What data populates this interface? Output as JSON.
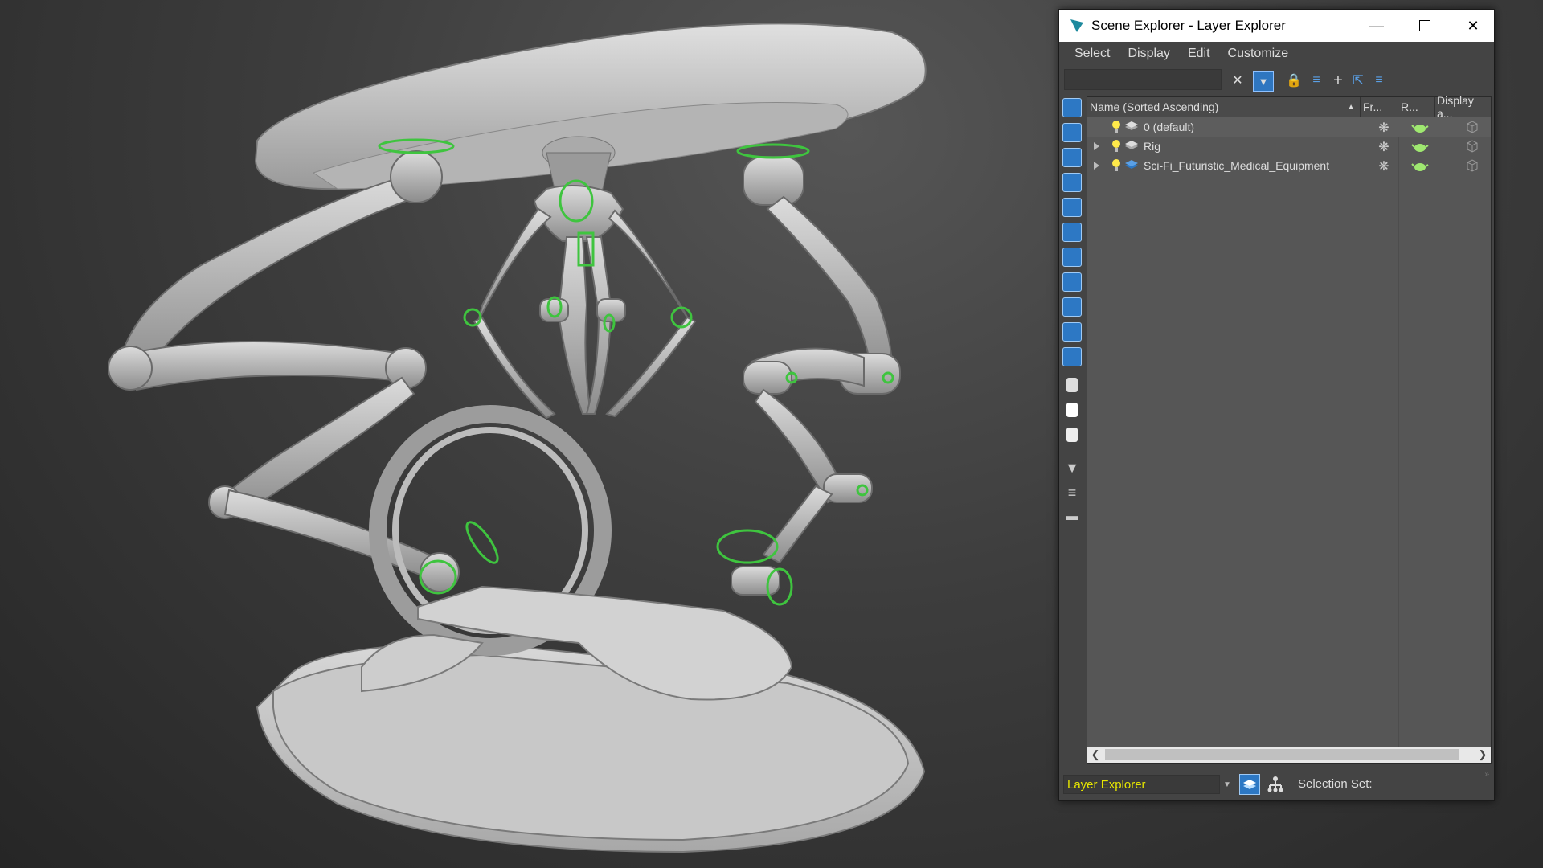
{
  "window": {
    "title": "Scene Explorer - Layer Explorer",
    "controls": [
      "minimize-icon",
      "maximize-icon",
      "close-icon"
    ]
  },
  "menu": [
    "Select",
    "Display",
    "Edit",
    "Customize"
  ],
  "search": {
    "value": "",
    "placeholder": ""
  },
  "toolbar_icons": [
    "clear-x-icon",
    "filter-toggle-icon",
    "lock-icon",
    "new-layer-icon",
    "add-icon",
    "select-objects-icon",
    "layer-select-icon"
  ],
  "left_strip_icons": [
    "geometry-icon",
    "shapes-icon",
    "lights-icon",
    "cameras-icon",
    "helpers-icon",
    "space-warps-icon",
    "groups-icon",
    "object-xrefs-icon",
    "bones-icon",
    "containers-icon",
    "frozen-icon",
    "hidden-icon",
    "all-icon",
    "none-icon",
    "invert-icon",
    "filter-icon",
    "funnel-list-icon",
    "collapse-icon"
  ],
  "columns": [
    "Name (Sorted Ascending)",
    "Fr...",
    "R...",
    "Display a..."
  ],
  "layers": [
    {
      "name": "0 (default)",
      "expandable": false,
      "selected": true
    },
    {
      "name": "Rig",
      "expandable": true,
      "selected": false
    },
    {
      "name": "Sci-Fi_Futuristic_Medical_Equipment",
      "expandable": true,
      "selected": false
    }
  ],
  "bottom": {
    "explorer_name": "Layer Explorer",
    "selection_set_label": "Selection Set:"
  },
  "colors": {
    "accent": "#2d78c4",
    "explorer_name_text": "#e6e600",
    "rig_helpers": "#3fc43f"
  }
}
